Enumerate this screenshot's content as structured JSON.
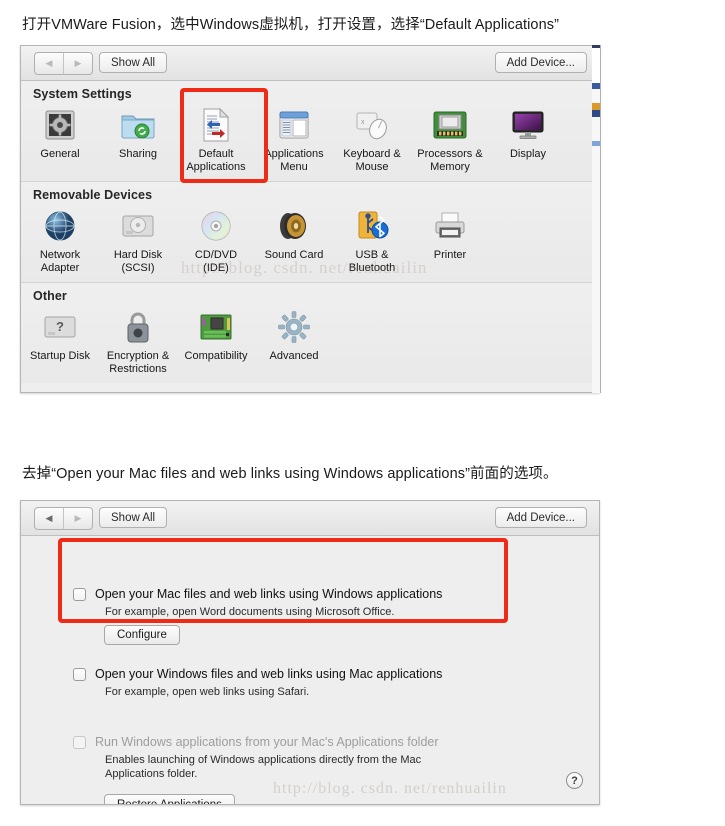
{
  "captions": {
    "first": "打开VMWare Fusion，选中Windows虚拟机，打开设置，选择“Default Applications”",
    "second": "去掉“Open your Mac files and web links using Windows applications”前面的选项。"
  },
  "toolbar": {
    "back_arrow": "◀",
    "forward_arrow": "▶",
    "show_all": "Show All",
    "add_device": "Add Device..."
  },
  "settings_window": {
    "groups": [
      {
        "title": "System Settings",
        "items": [
          {
            "label": "General",
            "icon": "gear-picture-icon"
          },
          {
            "label": "Sharing",
            "icon": "folder-sync-icon"
          },
          {
            "label": "Default\nApplications",
            "label_line1": "Default",
            "label_line2": "Applications",
            "icon": "document-arrows-icon",
            "highlighted": true
          },
          {
            "label_line1": "Applications",
            "label_line2": "Menu",
            "icon": "window-list-icon"
          },
          {
            "label_line1": "Keyboard &",
            "label_line2": "Mouse",
            "icon": "keyboard-mouse-icon"
          },
          {
            "label_line1": "Processors &",
            "label_line2": "Memory",
            "icon": "cpu-memory-icon"
          },
          {
            "label_line1": "Display",
            "label_line2": "",
            "icon": "monitor-icon"
          }
        ]
      },
      {
        "title": "Removable Devices",
        "items": [
          {
            "label_line1": "Network",
            "label_line2": "Adapter",
            "icon": "network-globe-icon"
          },
          {
            "label_line1": "Hard Disk",
            "label_line2": "(SCSI)",
            "icon": "hard-disk-icon"
          },
          {
            "label_line1": "CD/DVD",
            "label_line2": "(IDE)",
            "icon": "optical-disc-icon"
          },
          {
            "label_line1": "Sound Card",
            "label_line2": "",
            "icon": "speaker-icon"
          },
          {
            "label_line1": "USB &",
            "label_line2": "Bluetooth",
            "icon": "usb-bluetooth-icon"
          },
          {
            "label_line1": "Printer",
            "label_line2": "",
            "icon": "printer-icon"
          }
        ]
      },
      {
        "title": "Other",
        "items": [
          {
            "label_line1": "Startup Disk",
            "label_line2": "",
            "icon": "startup-disk-icon"
          },
          {
            "label_line1": "Encryption &",
            "label_line2": "Restrictions",
            "icon": "padlock-icon"
          },
          {
            "label_line1": "Compatibility",
            "label_line2": "",
            "icon": "motherboard-icon"
          },
          {
            "label_line1": "Advanced",
            "label_line2": "",
            "icon": "gear-icon"
          }
        ]
      }
    ]
  },
  "default_apps_pane": {
    "options": [
      {
        "label": "Open your Mac files and web links using Windows applications",
        "description": "For example, open Word documents using Microsoft Office.",
        "checked": false,
        "disabled": false,
        "button": "Configure"
      },
      {
        "label": "Open your Windows files and web links using Mac applications",
        "description": "For example, open web links using Safari.",
        "checked": false,
        "disabled": false
      },
      {
        "label": "Run Windows applications from your Mac's Applications folder",
        "description_line1": "Enables launching of Windows applications directly from the Mac",
        "description_line2": "Applications folder.",
        "checked": false,
        "disabled": true
      }
    ],
    "restore_button": "Restore Applications",
    "help_button": "?"
  },
  "watermarks": {
    "top": "http://blog. csdn. net/renhuailin",
    "bottom": "http://blog. csdn. net/renhuailin"
  },
  "colors": {
    "annotation_red": "#ef2a16",
    "panel_background": "#ececec",
    "text": "#101010"
  }
}
